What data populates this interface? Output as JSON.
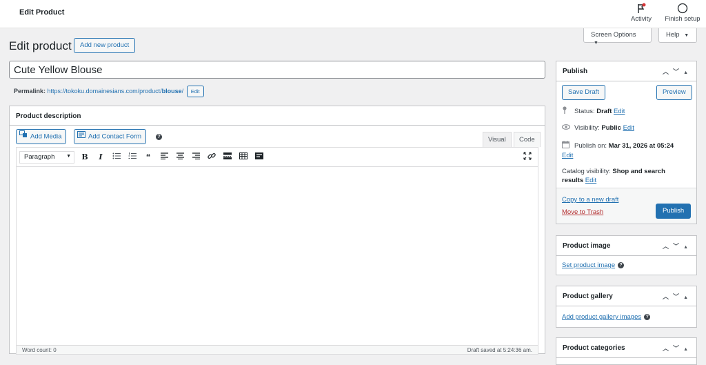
{
  "topbar": {
    "title": "Edit Product",
    "activity_label": "Activity",
    "finish_setup_label": "Finish setup"
  },
  "screen_options": {
    "label": "Screen Options"
  },
  "help": {
    "label": "Help"
  },
  "page": {
    "heading": "Edit product",
    "add_new_label": "Add new product"
  },
  "product": {
    "title": "Cute Yellow Blouse",
    "permalink_label": "Permalink:",
    "permalink_base": "https://tokoku.domainesians.com/product/",
    "permalink_slug": "blouse",
    "permalink_tail": "/",
    "permalink_edit": "Edit"
  },
  "description": {
    "header": "Product description",
    "add_media": "Add Media",
    "add_contact_form": "Add Contact Form",
    "tab_visual": "Visual",
    "tab_code": "Code",
    "format_select": "Paragraph",
    "tools": [
      "bold",
      "italic",
      "bulleted-list",
      "numbered-list",
      "blockquote",
      "align-left",
      "align-center",
      "align-right",
      "link",
      "read-more",
      "toolbar-toggle",
      "form"
    ],
    "word_count": "Word count: 0",
    "draft_saved": "Draft saved at 5:24:36 am."
  },
  "publish": {
    "header": "Publish",
    "save_draft": "Save Draft",
    "preview": "Preview",
    "status_label": "Status:",
    "status_value": "Draft",
    "visibility_label": "Visibility:",
    "visibility_value": "Public",
    "publish_on_label": "Publish on:",
    "publish_on_value": "Mar 31, 2026 at 05:24",
    "catalog_label": "Catalog visibility:",
    "catalog_value_1": "Shop and search",
    "catalog_value_2": "results",
    "edit": "Edit",
    "copy_draft": "Copy to a new draft",
    "move_trash": "Move to Trash",
    "publish_btn": "Publish"
  },
  "product_image": {
    "header": "Product image",
    "link": "Set product image"
  },
  "product_gallery": {
    "header": "Product gallery",
    "link": "Add product gallery images"
  },
  "product_categories": {
    "header": "Product categories"
  },
  "colors": {
    "accent": "#2271b1",
    "trash": "#b32d2e",
    "notification": "#d63638"
  }
}
